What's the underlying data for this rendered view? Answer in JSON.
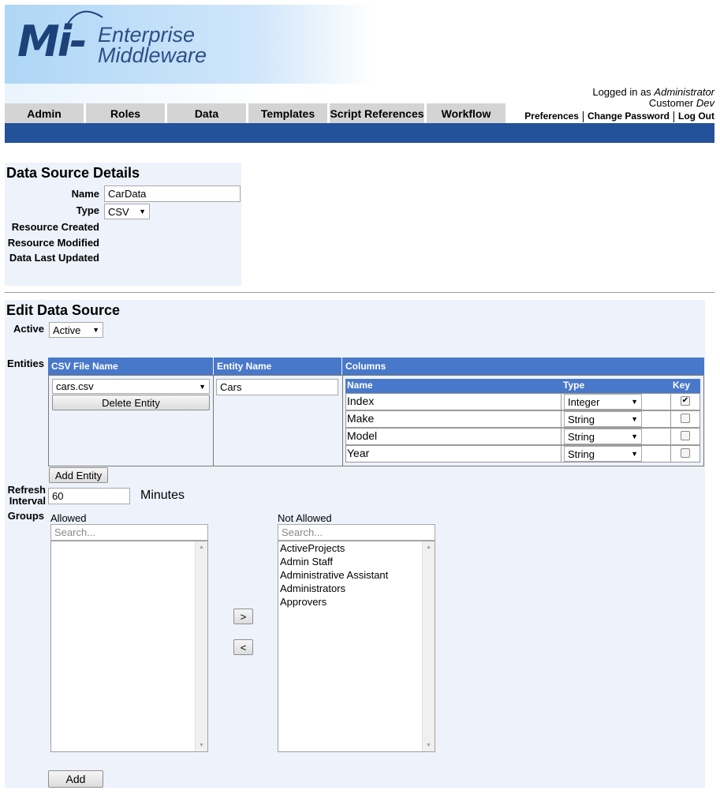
{
  "brand": {
    "mark": "Mi-",
    "line1": "Enterprise",
    "line2": "Middleware"
  },
  "nav": {
    "tabs": [
      "Admin",
      "Roles",
      "Data",
      "Templates",
      "Script References",
      "Workflow"
    ]
  },
  "user": {
    "logged_in_prefix": "Logged in as ",
    "username": "Administrator",
    "customer_prefix": "Customer ",
    "customer": "Dev",
    "links": [
      "Preferences",
      "Change Password",
      "Log Out"
    ]
  },
  "details": {
    "title": "Data Source Details",
    "name_label": "Name",
    "name_value": "CarData",
    "type_label": "Type",
    "type_value": "CSV",
    "created_label": "Resource Created",
    "modified_label": "Resource Modified",
    "updated_label": "Data Last Updated"
  },
  "edit": {
    "title": "Edit Data Source",
    "active_label": "Active",
    "active_value": "Active",
    "entities_label": "Entities",
    "headers": {
      "csv_file": "CSV File Name",
      "entity_name": "Entity Name",
      "columns": "Columns"
    },
    "csv_file_value": "cars.csv",
    "delete_entity": "Delete Entity",
    "entity_name_value": "Cars",
    "columns": {
      "name_header": "Name",
      "type_header": "Type",
      "key_header": "Key",
      "rows": [
        {
          "name": "Index",
          "type": "Integer",
          "key": "✔"
        },
        {
          "name": "Make",
          "type": "String",
          "key": ""
        },
        {
          "name": "Model",
          "type": "String",
          "key": ""
        },
        {
          "name": "Year",
          "type": "String",
          "key": ""
        }
      ]
    },
    "add_entity": "Add Entity",
    "refresh_label_1": "Refresh",
    "refresh_label_2": "Interval",
    "refresh_value": "60",
    "refresh_unit": "Minutes",
    "groups_label": "Groups",
    "allowed_label": "Allowed",
    "not_allowed_label": "Not Allowed",
    "search_placeholder": "Search...",
    "not_allowed_items": [
      "ActiveProjects",
      "Admin Staff",
      "Administrative Assistant",
      "Administrators",
      "Approvers"
    ],
    "move_right": ">",
    "move_left": "<",
    "add_button": "Add"
  },
  "colors": {
    "nav_bar": "#23519a",
    "table_header": "#4878c9",
    "panel": "#edf2fb",
    "tab": "#d4d4d4"
  }
}
